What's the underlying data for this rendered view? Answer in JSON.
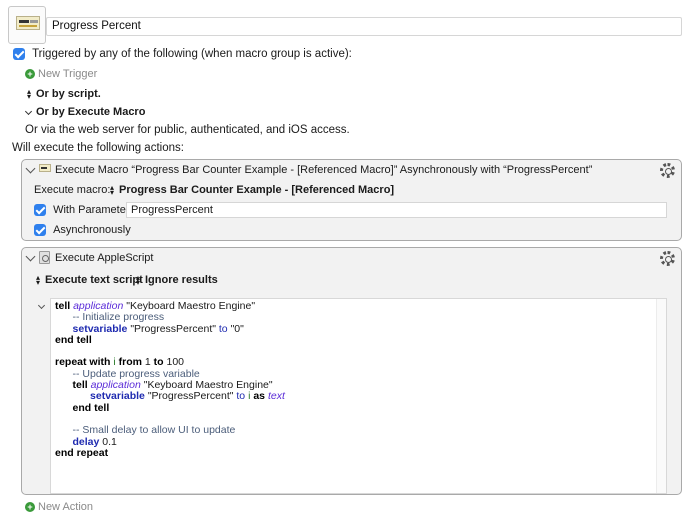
{
  "macro": {
    "title": "Progress Percent"
  },
  "triggers": {
    "triggered_label": "Triggered by any of the following (when macro group is active):",
    "new_trigger_label": "New Trigger",
    "or_by_script": "Or by script.",
    "or_by_execute_macro": "Or by Execute Macro",
    "web_server_text": "Or via the web server for public, authenticated, and iOS access."
  },
  "actions_label": "Will execute the following actions:",
  "action1": {
    "title": "Execute Macro “Progress Bar Counter Example - [Referenced Macro]” Asynchronously with “ProgressPercent”",
    "execute_macro_label": "Execute macro:",
    "execute_macro_value": "Progress Bar Counter Example - [Referenced Macro]",
    "with_parameter_label": "With Parameter",
    "parameter_value": "ProgressPercent",
    "asynchronously_label": "Asynchronously"
  },
  "action2": {
    "title": "Execute AppleScript",
    "execute_text_script": "Execute text script",
    "ignore_results": "Ignore results",
    "code": {
      "l1_kw": "tell",
      "l1_cls": "application",
      "l1_str": "\"Keyboard Maestro Engine\"",
      "l2_cmt": "-- Initialize progress",
      "l3_cmd": "setvariable",
      "l3_str": "\"ProgressPercent\"",
      "l3_op": "to",
      "l3_val": "\"0\"",
      "l4_kw": "end tell",
      "l6_kw": "repeat with",
      "l6_var": "i",
      "l6_from": "from",
      "l6_start": "1",
      "l6_to": "to",
      "l6_end": "100",
      "l7_cmt": "-- Update progress variable",
      "l8_kw": "tell",
      "l8_cls": "application",
      "l8_str": "\"Keyboard Maestro Engine\"",
      "l9_cmd": "setvariable",
      "l9_str": "\"ProgressPercent\"",
      "l9_op": "to",
      "l9_var": "i",
      "l9_as": "as",
      "l9_cls": "text",
      "l10_kw": "end tell",
      "l12_cmt": "-- Small delay to allow UI to update",
      "l13_cmd": "delay",
      "l13_val": "0.1",
      "l14_kw": "end repeat"
    }
  },
  "new_action_label": "New Action",
  "colors": {
    "checkbox": "#2f80ed",
    "plus_button": "#3a9a3a",
    "applescript_class": "#5a2bd8",
    "applescript_command": "#1f2bb0"
  },
  "icons": {
    "macro_icon": "progress-bar-thumbnail-icon",
    "gear": "gear-icon",
    "script": "applescript-icon"
  }
}
